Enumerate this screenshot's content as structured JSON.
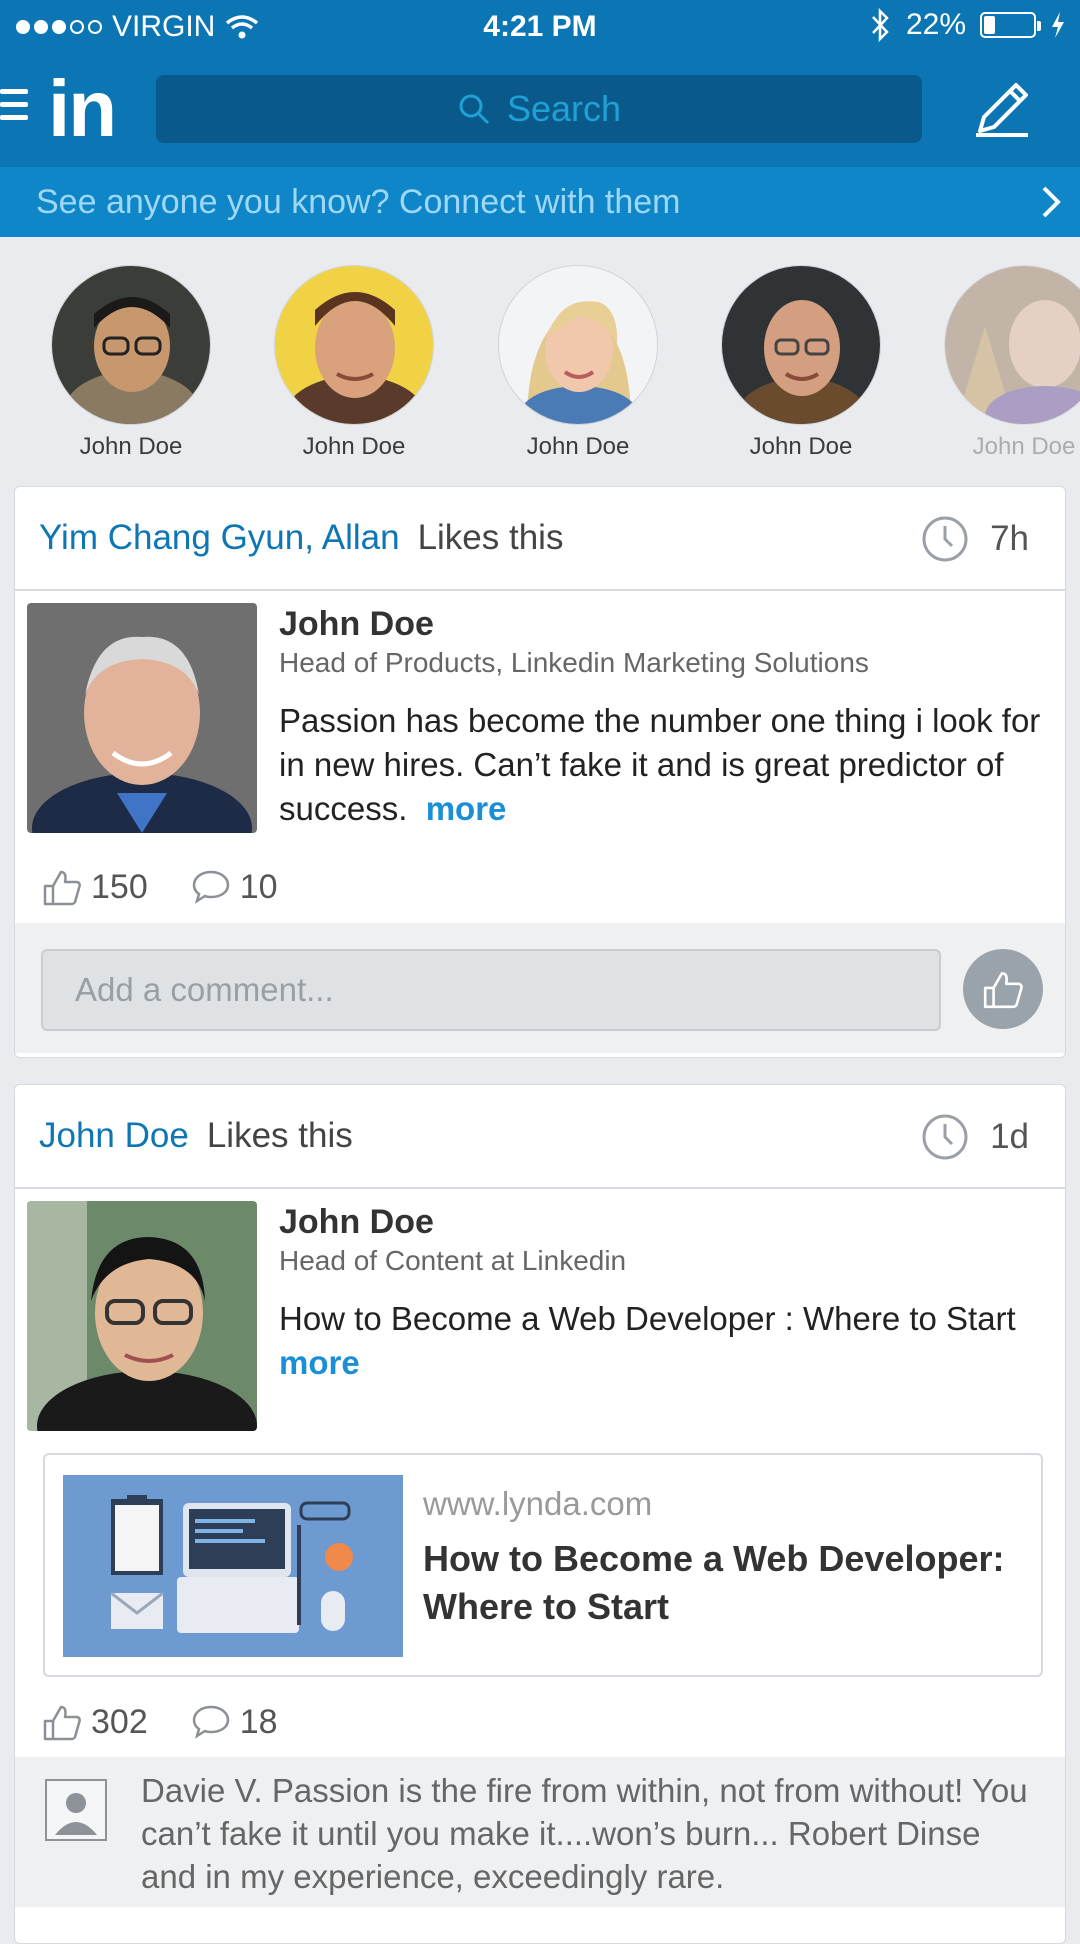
{
  "status_bar": {
    "carrier": "VIRGIN",
    "time": "4:21 PM",
    "battery": "22%",
    "battery_level": 0.22,
    "signal_bars_filled": 3,
    "signal_bars_total": 5
  },
  "nav": {
    "logo": "in",
    "search_placeholder": "Search",
    "icons": {
      "menu": "hamburger-icon",
      "search": "search-icon",
      "compose": "pencil-icon"
    }
  },
  "banner": {
    "text": "See anyone you know? Connect with them"
  },
  "people": [
    {
      "name": "John Doe"
    },
    {
      "name": "John Doe"
    },
    {
      "name": "John Doe"
    },
    {
      "name": "John Doe"
    },
    {
      "name": "John Doe"
    }
  ],
  "feed": [
    {
      "actor": "Yim Chang Gyun, Allan",
      "action": "Likes this",
      "time_ago": "7h",
      "author": "John Doe",
      "role": "Head of Products, Linkedin Marketing Solutions",
      "text": "Passion has become the number one thing i look for in new hires. Can’t fake it and is great predictor of success.",
      "more": "more",
      "likes": "150",
      "comments": "10",
      "comment_placeholder": "Add a comment..."
    },
    {
      "actor": "John Doe",
      "action": "Likes this",
      "time_ago": "1d",
      "author": "John Doe",
      "role": "Head of Content at Linkedin",
      "text": "How to Become a Web Developer : Where to Start",
      "more": "more",
      "link": {
        "url": "www.lynda.com",
        "title": "How to Become a Web Developer: Where to Start"
      },
      "likes": "302",
      "comments": "18",
      "comment_preview": "Davie V. Passion is the fire from within, not from without! You can’t fake it until you make it....won’s burn... Robert Dinse and in my experience, exceedingly rare."
    }
  ],
  "colors": {
    "brand": "#0c76b4",
    "banner": "#0e86c8",
    "link": "#0e76b4",
    "more": "#1a8fd6",
    "background": "#e9ebee"
  }
}
